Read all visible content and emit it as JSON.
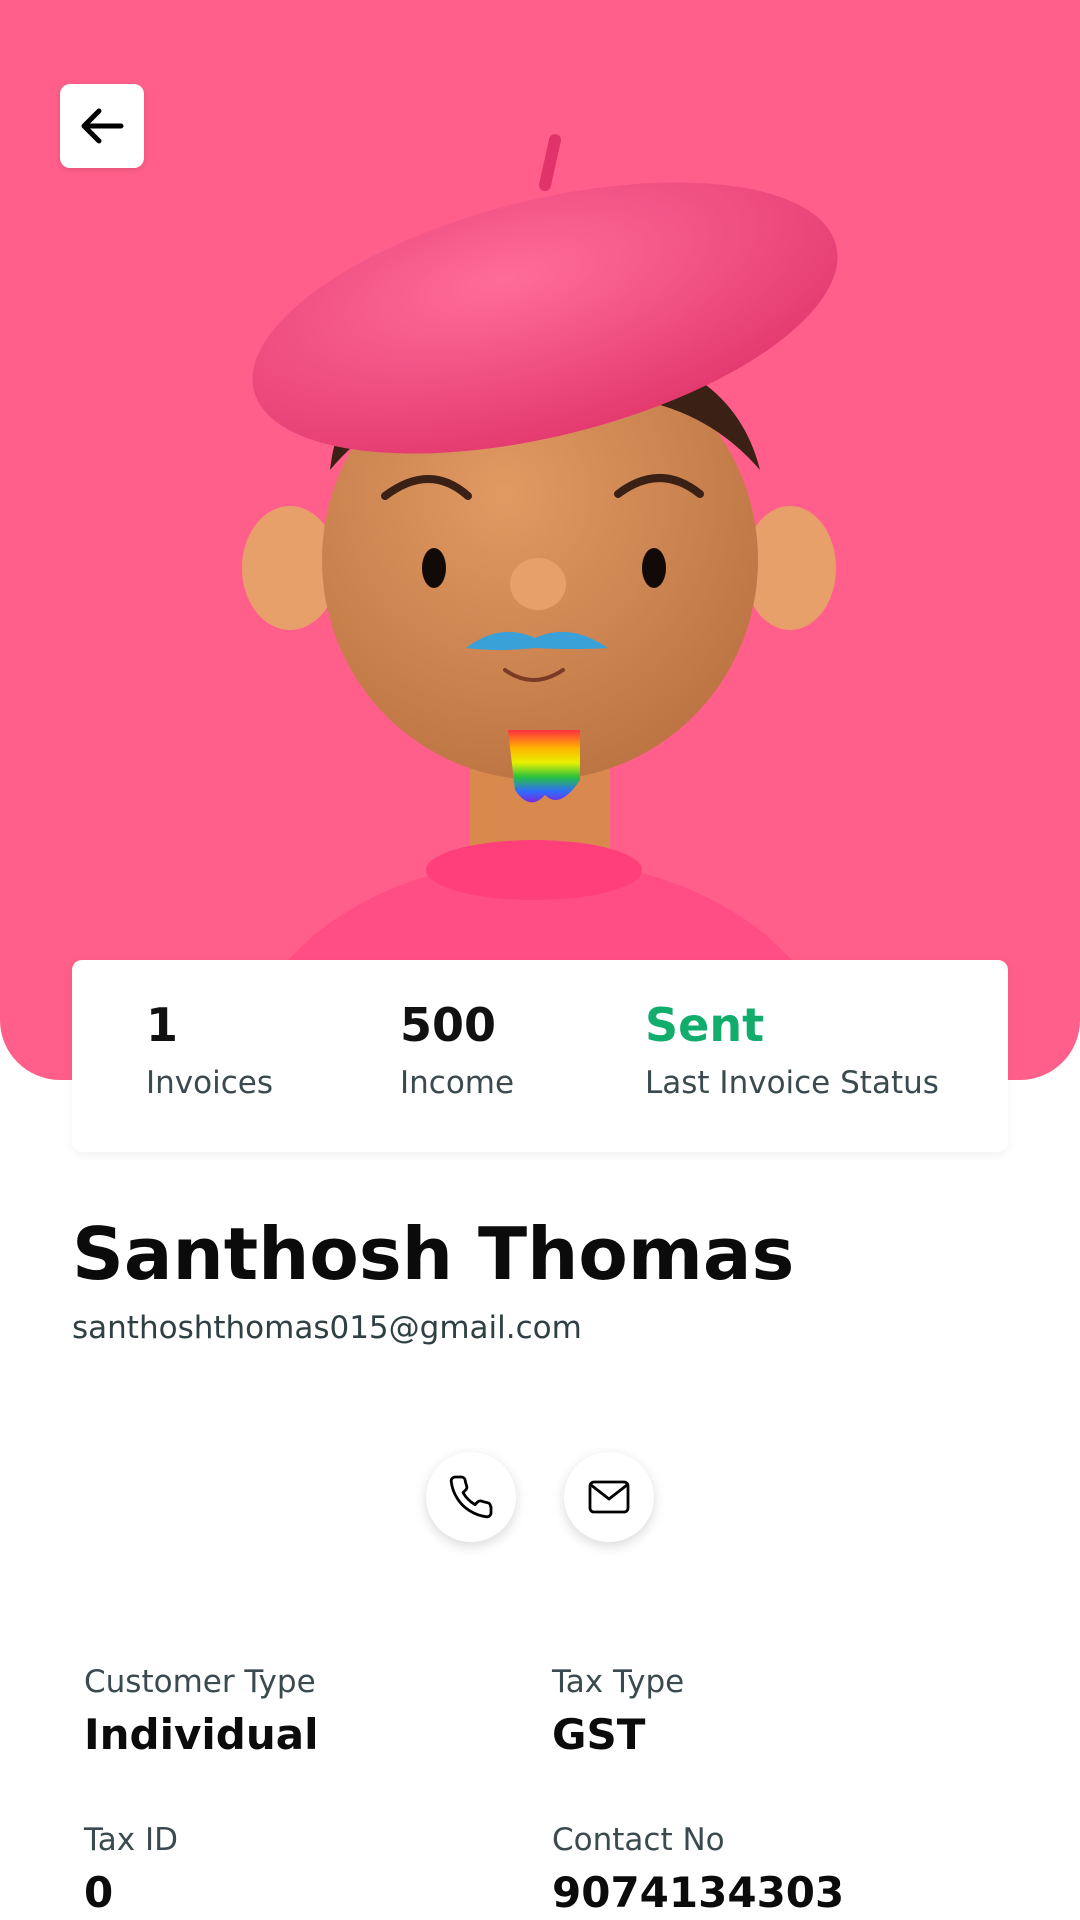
{
  "theme": {
    "hero_color": "#ff5f8a",
    "status_color": "#12ad6d"
  },
  "header": {
    "back_icon": "arrow-left-icon"
  },
  "stats": {
    "invoices_value": "1",
    "invoices_label": "Invoices",
    "income_value": "500",
    "income_label": "Income",
    "status_value": "Sent",
    "status_label": "Last Invoice Status"
  },
  "profile": {
    "name": "Santhosh Thomas",
    "email": "santhoshthomas015@gmail.com"
  },
  "actions": {
    "call_icon": "phone-icon",
    "mail_icon": "mail-icon"
  },
  "details": [
    {
      "label": "Customer Type",
      "value": "Individual"
    },
    {
      "label": "Tax Type",
      "value": "GST"
    },
    {
      "label": "Tax ID",
      "value": "0"
    },
    {
      "label": "Contact No",
      "value": "9074134303"
    }
  ]
}
